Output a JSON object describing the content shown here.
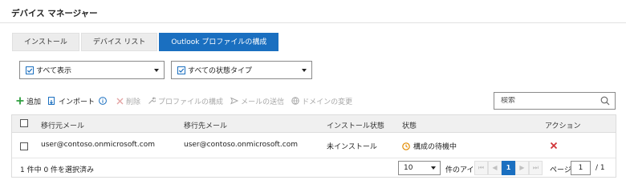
{
  "header": {
    "title": "デバイス マネージャー"
  },
  "tabs": [
    {
      "label": "インストール",
      "active": false
    },
    {
      "label": "デバイス リスト",
      "active": false
    },
    {
      "label": "Outlook プロファイルの構成",
      "active": true
    }
  ],
  "filters": {
    "view": {
      "selected": "すべて表示"
    },
    "status_type": {
      "selected": "すべての状態タイプ"
    }
  },
  "toolbar": {
    "add": "追加",
    "import": "インポート",
    "delete": "削除",
    "configure_profile": "プロファイルの構成",
    "send_mail": "メールの送信",
    "change_domain": "ドメインの変更"
  },
  "search": {
    "placeholder": "検索"
  },
  "table": {
    "columns": [
      "移行元メール",
      "移行先メール",
      "インストール状態",
      "状態",
      "アクション"
    ],
    "rows": [
      {
        "source_email": "user@contoso.onmicrosoft.com",
        "target_email": "user@contoso.onmicrosoft.com",
        "install_status": "未インストール",
        "status": "構成の待機中"
      }
    ]
  },
  "footer": {
    "selection_text": "1 件中 0 件を選択済み",
    "page_size": "10",
    "items_label": "件のアイテム",
    "current_page": "1",
    "page_label": "ページ",
    "page_input": "1",
    "total_pages": "/ 1"
  },
  "colors": {
    "accent": "#1a6fc0",
    "add": "#2e9e3e",
    "delete": "#d13438",
    "pending": "#e38b00"
  }
}
